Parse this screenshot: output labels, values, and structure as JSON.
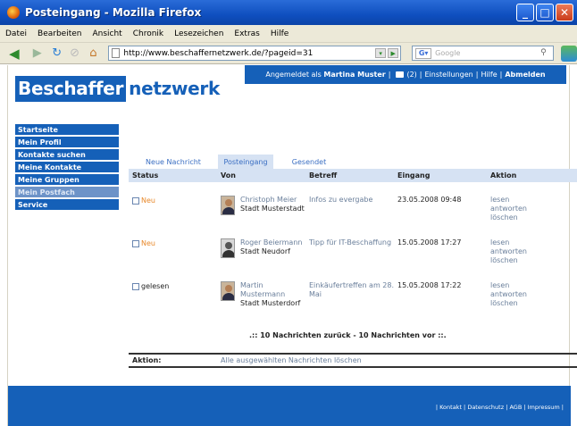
{
  "window": {
    "title": "Posteingang - Mozilla Firefox"
  },
  "menu": [
    "Datei",
    "Bearbeiten",
    "Ansicht",
    "Chronik",
    "Lesezeichen",
    "Extras",
    "Hilfe"
  ],
  "url": "http://www.beschaffernetzwerk.de/?pageid=31",
  "search_placeholder": "Google",
  "topbar": {
    "logged_in_prefix": "Angemeldet als",
    "user": "Martina Muster",
    "mail_count": "(2)",
    "settings": "Einstellungen",
    "help": "Hilfe",
    "logout": "Abmelden"
  },
  "logo": {
    "part1": "Beschaffer",
    "part2": "netzwerk"
  },
  "sidenav": [
    {
      "label": "Startseite"
    },
    {
      "label": "Mein Profil"
    },
    {
      "label": "Kontakte suchen"
    },
    {
      "label": "Meine Kontakte"
    },
    {
      "label": "Meine Gruppen"
    },
    {
      "label": "Mein Postfach",
      "active": true
    },
    {
      "label": "Service"
    }
  ],
  "tabs": [
    "Neue Nachricht",
    "Posteingang",
    "Gesendet"
  ],
  "columns": {
    "status": "Status",
    "from": "Von",
    "subject": "Betreff",
    "date": "Eingang",
    "action": "Aktion"
  },
  "messages": [
    {
      "status": "Neu",
      "from_name": "Christoph Meier",
      "from_city": "Stadt Musterstadt",
      "subject": "Infos zu evergabe",
      "date": "23.05.2008 09:48"
    },
    {
      "status": "Neu",
      "from_name": "Roger Beiermann",
      "from_city": "Stadt Neudorf",
      "subject": "Tipp für IT-Beschaffung",
      "date": "15.05.2008 17:27"
    },
    {
      "status": "gelesen",
      "from_name": "Martin Mustermann",
      "from_city": "Stadt Musterdorf",
      "subject": "Einkäufertreffen am 28. Mai",
      "date": "15.05.2008 17:22"
    }
  ],
  "row_actions": {
    "read": "lesen",
    "reply": "antworten",
    "delete": "löschen"
  },
  "pager": ".:: 10 Nachrichten zurück - 10 Nachrichten vor ::.",
  "action_label": "Aktion:",
  "delete_selected": "Alle ausgewählten Nachrichten löschen",
  "footer": "| Kontakt | Datenschutz | AGB | Impressum |"
}
